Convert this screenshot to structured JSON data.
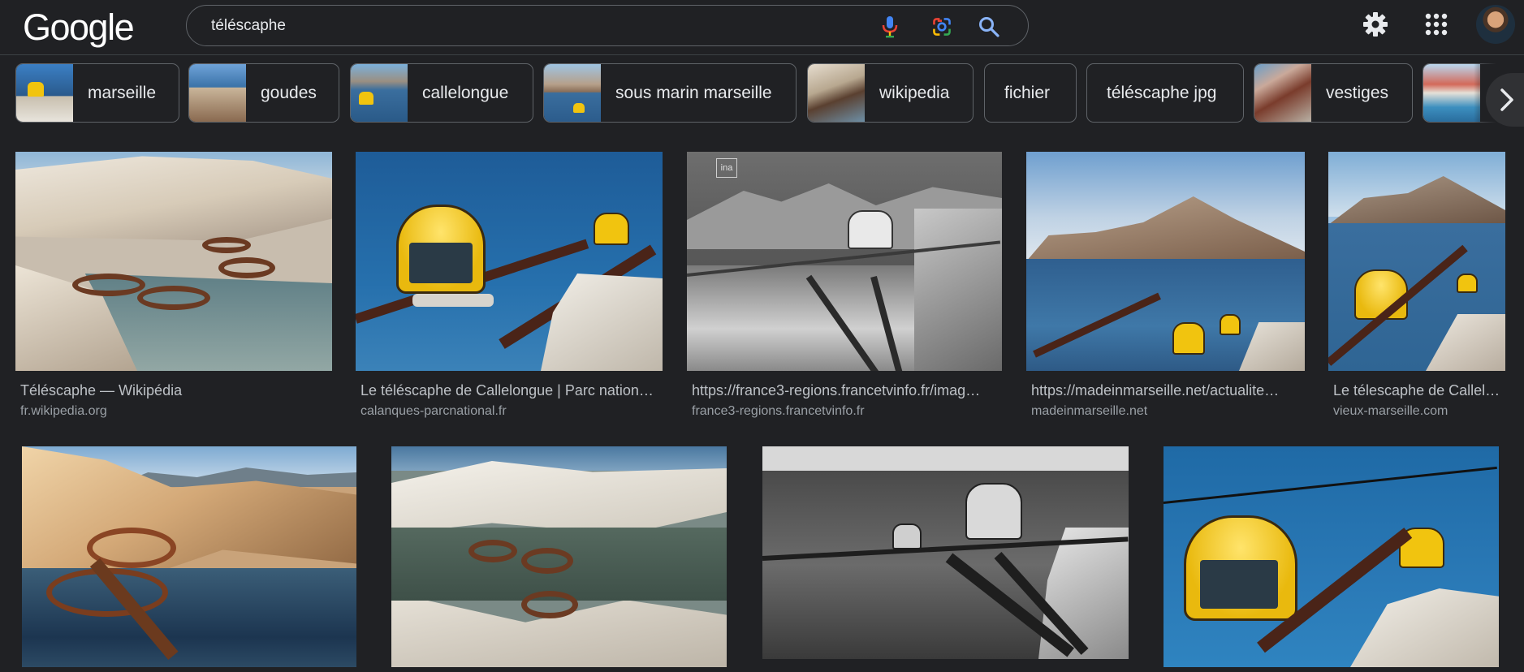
{
  "header": {
    "logo_text": "Google",
    "search_value": "téléscaphe",
    "icons": [
      "microphone-icon",
      "google-lens-icon",
      "search-icon",
      "settings-gear-icon",
      "apps-grid-icon",
      "account-avatar"
    ]
  },
  "chips": [
    {
      "label": "marseille",
      "thumb": true
    },
    {
      "label": "goudes",
      "thumb": true
    },
    {
      "label": "callelongue",
      "thumb": true
    },
    {
      "label": "sous marin marseille",
      "thumb": true
    },
    {
      "label": "wikipedia",
      "thumb": true
    },
    {
      "label": "fichier",
      "thumb": false
    },
    {
      "label": "téléscaphe jpg",
      "thumb": false
    },
    {
      "label": "vestiges",
      "thumb": true
    },
    {
      "label": "",
      "thumb": true
    }
  ],
  "results_row1": [
    {
      "title": "Téléscaphe — Wikipédia",
      "source": "fr.wikipedia.org"
    },
    {
      "title": "Le téléscaphe de Callelongue | Parc nation…",
      "source": "calanques-parcnational.fr"
    },
    {
      "title": "https://france3-regions.francetvinfo.fr/imag…",
      "source": "france3-regions.francetvinfo.fr"
    },
    {
      "title": "https://madeinmarseille.net/actualite…",
      "source": "madeinmarseille.net"
    },
    {
      "title": "Le télescaphe de Callel…",
      "source": "vieux-marseille.com"
    }
  ],
  "results_row2": [
    {
      "title": "",
      "source": ""
    },
    {
      "title": "",
      "source": ""
    },
    {
      "title": "",
      "source": ""
    },
    {
      "title": "",
      "source": ""
    }
  ],
  "image_watermark": "ina",
  "colors": {
    "background": "#202124",
    "border": "#5f6368",
    "text_primary": "#e8eaed",
    "text_secondary": "#9aa0a6",
    "mic_blue": "#4285f4",
    "mic_red": "#ea4335",
    "pod_yellow": "#f1c40f"
  }
}
